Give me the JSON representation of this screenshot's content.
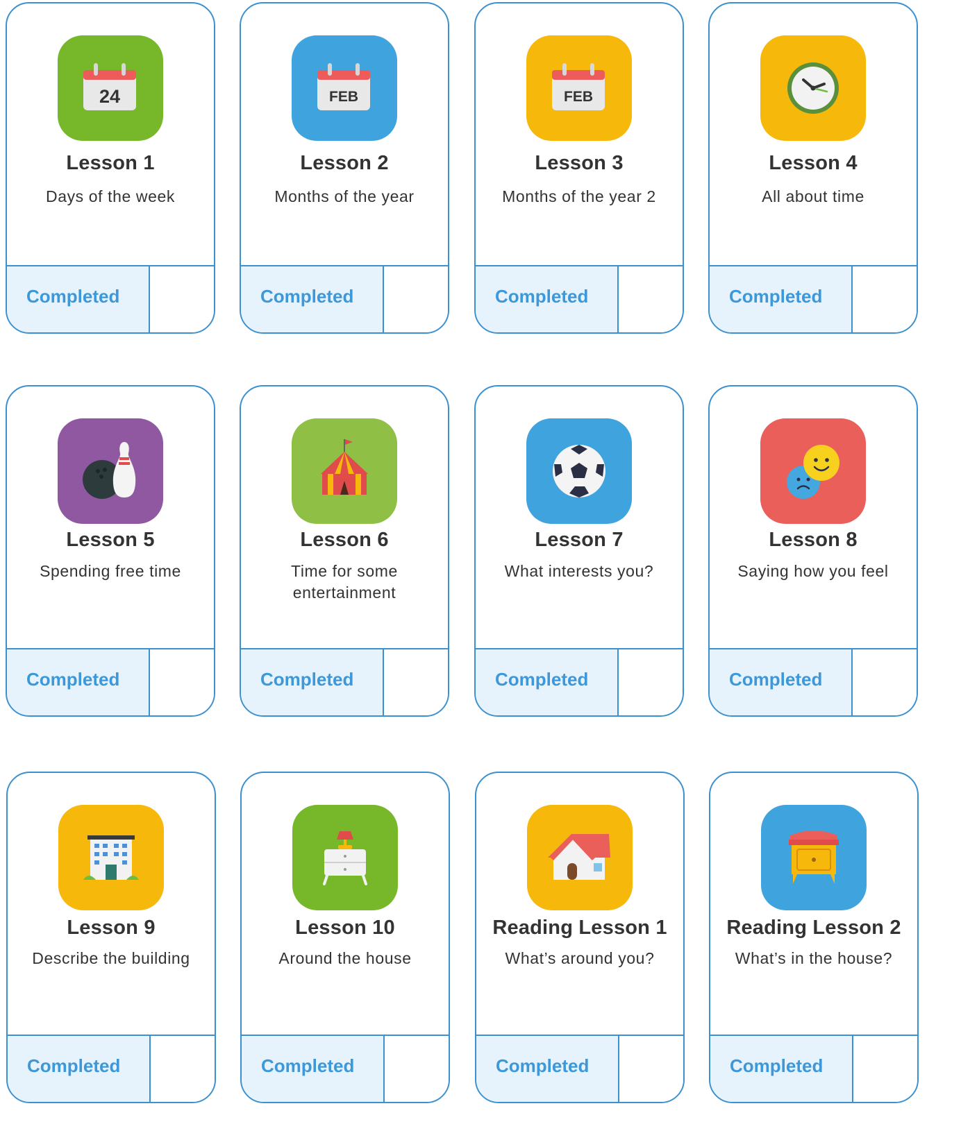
{
  "lessons": [
    {
      "title": "Lesson 1",
      "subtitle": "Days of the week",
      "status": "Completed",
      "icon": "calendar-24-icon",
      "icon_text": "24",
      "bg": "#77b82a"
    },
    {
      "title": "Lesson 2",
      "subtitle": "Months of the year",
      "status": "Completed",
      "icon": "calendar-feb-icon",
      "icon_text": "FEB",
      "bg": "#3fa3de"
    },
    {
      "title": "Lesson 3",
      "subtitle": "Months of the year 2",
      "status": "Completed",
      "icon": "calendar-feb-icon",
      "icon_text": "FEB",
      "bg": "#f5b80b"
    },
    {
      "title": "Lesson 4",
      "subtitle": "All about time",
      "status": "Completed",
      "icon": "clock-icon",
      "bg": "#f5b80b"
    },
    {
      "title": "Lesson 5",
      "subtitle": "Spending free time",
      "status": "Completed",
      "icon": "bowling-icon",
      "bg": "#9058a0"
    },
    {
      "title": "Lesson 6",
      "subtitle": "Time for some entertainment",
      "status": "Completed",
      "icon": "circus-tent-icon",
      "bg": "#8fbf45"
    },
    {
      "title": "Lesson 7",
      "subtitle": "What interests you?",
      "status": "Completed",
      "icon": "soccer-ball-icon",
      "bg": "#3fa3de"
    },
    {
      "title": "Lesson 8",
      "subtitle": "Saying how you feel",
      "status": "Completed",
      "icon": "emotions-icon",
      "bg": "#ea5f5a"
    },
    {
      "title": "Lesson 9",
      "subtitle": "Describe the building",
      "status": "Completed",
      "icon": "building-icon",
      "bg": "#f5b80b"
    },
    {
      "title": "Lesson 10",
      "subtitle": "Around the house",
      "status": "Completed",
      "icon": "nightstand-lamp-icon",
      "bg": "#77b82a"
    },
    {
      "title": "Reading Lesson 1",
      "subtitle": "What’s around you?",
      "status": "Completed",
      "icon": "house-icon",
      "bg": "#f5b80b"
    },
    {
      "title": "Reading Lesson 2",
      "subtitle": "What’s in the house?",
      "status": "Completed",
      "icon": "dresser-icon",
      "bg": "#3fa3de"
    }
  ]
}
